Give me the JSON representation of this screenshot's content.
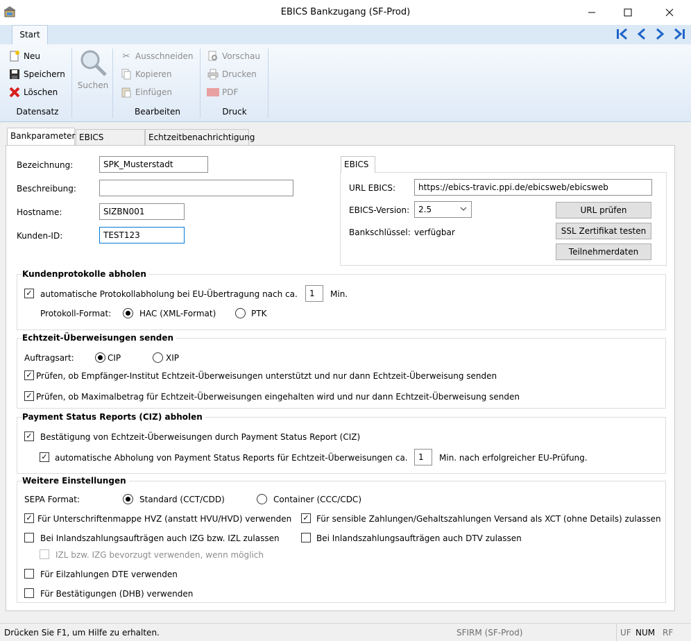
{
  "window": {
    "title": "EBICS Bankzugang (SF-Prod)"
  },
  "ribbon": {
    "tab_start": "Start",
    "datensatz": {
      "neu": "Neu",
      "speichern": "Speichern",
      "loeschen": "Löschen",
      "label": "Datensatz"
    },
    "suchen": "Suchen",
    "bearbeiten": {
      "ausschneiden": "Ausschneiden",
      "kopieren": "Kopieren",
      "einfuegen": "Einfügen",
      "label": "Bearbeiten"
    },
    "druck": {
      "vorschau": "Vorschau",
      "drucken": "Drucken",
      "pdf": "PDF",
      "label": "Druck"
    }
  },
  "tabs": [
    "Bankparameter",
    "EBICS Benutzer",
    "Echtzeitbenachrichtigung"
  ],
  "bank": {
    "bezeichnung_label": "Bezeichnung:",
    "bezeichnung_value": "SPK_Musterstadt",
    "beschreibung_label": "Beschreibung:",
    "beschreibung_value": "",
    "hostname_label": "Hostname:",
    "hostname_value": "SIZBN001",
    "kunden_label": "Kunden-ID:",
    "kunden_value": "TEST123"
  },
  "ebics": {
    "tab": "EBICS",
    "url_label": "URL EBICS:",
    "url_value": "https://ebics-travic.ppi.de/ebicsweb/ebicsweb",
    "version_label": "EBICS-Version:",
    "version_value": "2.5",
    "key_label": "Bankschlüssel:",
    "key_value": "verfügbar",
    "btn_url": "URL prüfen",
    "btn_ssl": "SSL Zertifikat testen",
    "btn_teil": "Teilnehmerdaten"
  },
  "kunden": {
    "title": "Kundenprotokolle abholen",
    "auto_label": "automatische Protokollabholung bei EU-Übertragung nach ca.",
    "auto_min": "1",
    "min": "Min.",
    "format_label": "Protokoll-Format:",
    "hac": "HAC (XML-Format)",
    "ptk": "PTK"
  },
  "echtzeit": {
    "title": "Echtzeit-Überweisungen senden",
    "auftrag_label": "Auftragsart:",
    "cip": "CIP",
    "xip": "XIP",
    "check1": "Prüfen, ob Empfänger-Institut Echtzeit-Überweisungen unterstützt und nur dann Echtzeit-Überweisung senden",
    "check2": "Prüfen, ob Maximalbetrag für Echtzeit-Überweisungen eingehalten wird und nur dann Echtzeit-Überweisung senden"
  },
  "psr": {
    "title": "Payment Status Reports (CIZ) abholen",
    "check1": "Bestätigung von Echtzeit-Überweisungen durch Payment Status Report (CIZ)",
    "check2": "automatische Abholung von Payment Status Reports für Echtzeit-Überweisungen ca.",
    "min_value": "1",
    "suffix": "Min. nach erfolgreicher EU-Prüfung."
  },
  "weitere": {
    "title": "Weitere Einstellungen",
    "sepa_label": "SEPA Format:",
    "standard": "Standard (CCT/CDD)",
    "container": "Container (CCC/CDC)",
    "hvz": "Für Unterschriftenmappe HVZ (anstatt HVU/HVD) verwenden",
    "xct": "Für sensible Zahlungen/Gehaltszahlungen Versand als XCT (ohne Details) zulassen",
    "izg": "Bei Inlandszahlungsaufträgen auch IZG bzw. IZL zulassen",
    "dtv": "Bei Inlandszahlungsaufträgen auch DTV zulassen",
    "izl_pref": "IZL bzw. IZG bevorzugt verwenden, wenn möglich",
    "dte": "Für Eilzahlungen DTE verwenden",
    "dhb": "Für Bestätigungen (DHB) verwenden"
  },
  "status": {
    "help": "Drücken Sie F1, um Hilfe zu erhalten.",
    "center": "SFIRM (SF-Prod)",
    "uf": "UF",
    "num": "NUM",
    "rf": "RF"
  }
}
